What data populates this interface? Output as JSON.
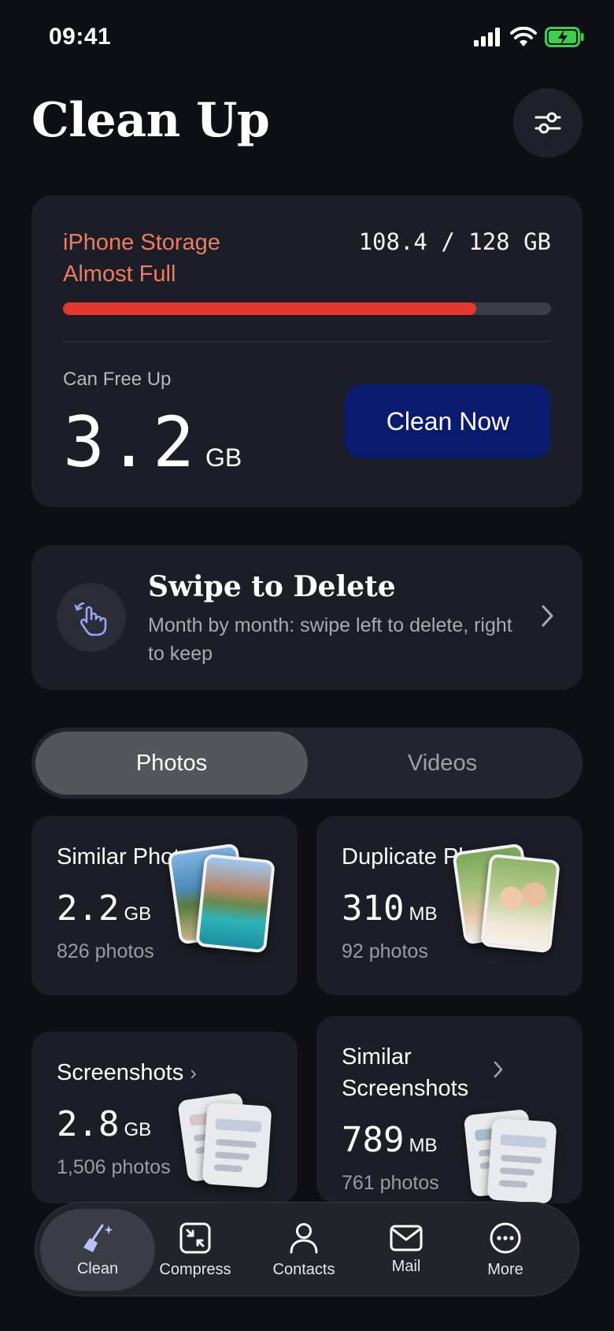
{
  "status_bar": {
    "time": "09:41"
  },
  "header": {
    "title": "Clean Up"
  },
  "storage": {
    "warning": "iPhone Storage Almost Full",
    "usage": "108.4 / 128 GB",
    "used_fraction": 0.847,
    "free_label": "Can Free Up",
    "free_value": "3.2",
    "free_unit": "GB",
    "cta": "Clean Now"
  },
  "swipe": {
    "title": "Swipe to Delete",
    "description": "Month by month: swipe left to delete, right to keep"
  },
  "segment": {
    "tabs": [
      "Photos",
      "Videos"
    ],
    "active": "Photos"
  },
  "categories": [
    {
      "title": "Similar Photos",
      "size": "2.2",
      "unit": "GB",
      "count": "826 photos"
    },
    {
      "title": "Duplicate Photos",
      "size": "310",
      "unit": "MB",
      "count": "92 photos"
    },
    {
      "title": "Screenshots",
      "size": "2.8",
      "unit": "GB",
      "count": "1,506 photos"
    },
    {
      "title": "Similar Screenshots",
      "size": "789",
      "unit": "MB",
      "count": "761 photos"
    }
  ],
  "tab_bar": [
    {
      "label": "Clean",
      "icon": "broom-sparkle-icon",
      "active": true
    },
    {
      "label": "Compress",
      "icon": "compress-icon",
      "active": false
    },
    {
      "label": "Contacts",
      "icon": "person-icon",
      "active": false
    },
    {
      "label": "Mail",
      "icon": "envelope-icon",
      "active": false
    },
    {
      "label": "More",
      "icon": "ellipsis-circle-icon",
      "active": false
    }
  ],
  "colors": {
    "warning": "#f07a60",
    "progress": "#e3382b",
    "cta": "#0a1a6e",
    "background": "#0d0f14",
    "card": "#1b1e26"
  }
}
